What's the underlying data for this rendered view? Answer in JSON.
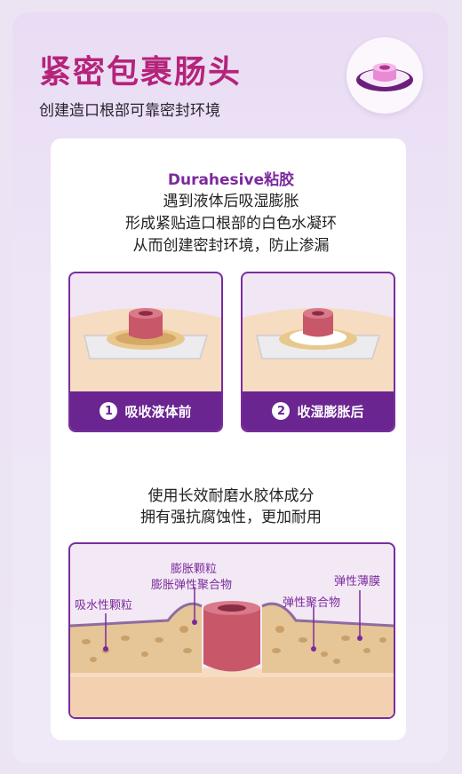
{
  "header": {
    "title": "紧密包裹肠头",
    "subtitle": "创建造口根部可靠密封环境"
  },
  "intro": {
    "brand": "Durahesive粘胶",
    "line1": "遇到液体后吸湿膨胀",
    "line2": "形成紧贴造口根部的白色水凝环",
    "line3": "从而创建密封环境，防止渗漏"
  },
  "panels": [
    {
      "num": "1",
      "label": "吸收液体前"
    },
    {
      "num": "2",
      "label": "收湿膨胀后"
    }
  ],
  "feature": {
    "line1": "使用长效耐磨水胶体成分",
    "line2": "拥有强抗腐蚀性，更加耐用"
  },
  "diagram_labels": {
    "absorbent": "吸水性颗粒",
    "swell1": "膨胀颗粒",
    "swell2": "膨胀弹性聚合物",
    "elastic_polymer": "弹性聚合物",
    "elastic_film": "弹性薄膜"
  },
  "colors": {
    "title": "#b5247a",
    "accent": "#6a2591",
    "skin": "#f6dcc0",
    "stoma": "#c8576a"
  }
}
